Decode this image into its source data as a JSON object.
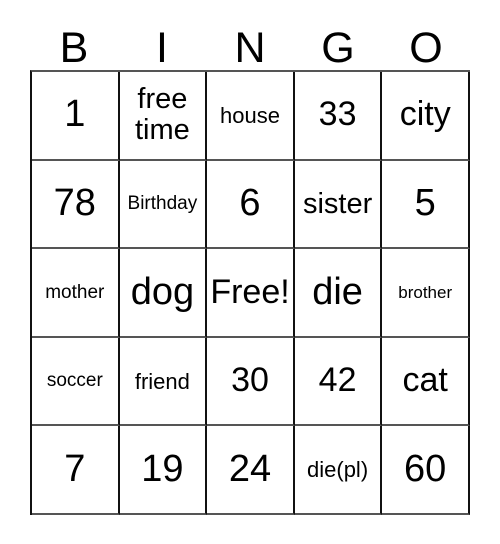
{
  "card": {
    "header": {
      "letters": [
        "B",
        "I",
        "N",
        "G",
        "O"
      ]
    },
    "grid": {
      "rows": 5,
      "columns": 5,
      "free_space_label": "Free!",
      "cells": [
        [
          {
            "text": "1",
            "size": "fs-xl"
          },
          {
            "text": "free time",
            "size": "fs-md",
            "wrap": true
          },
          {
            "text": "house",
            "size": "fs-sm"
          },
          {
            "text": "33",
            "size": "fs-lg"
          },
          {
            "text": "city",
            "size": "fs-lg"
          }
        ],
        [
          {
            "text": "78",
            "size": "fs-xl"
          },
          {
            "text": "Birthday",
            "size": "fs-xs"
          },
          {
            "text": "6",
            "size": "fs-xl"
          },
          {
            "text": "sister",
            "size": "fs-md"
          },
          {
            "text": "5",
            "size": "fs-xl"
          }
        ],
        [
          {
            "text": "mother",
            "size": "fs-xs"
          },
          {
            "text": "dog",
            "size": "fs-xl"
          },
          {
            "text": "Free!",
            "size": "fs-lg"
          },
          {
            "text": "die",
            "size": "fs-xl"
          },
          {
            "text": "brother",
            "size": "fs-xxs"
          }
        ],
        [
          {
            "text": "soccer",
            "size": "fs-xs"
          },
          {
            "text": "friend",
            "size": "fs-sm"
          },
          {
            "text": "30",
            "size": "fs-lg"
          },
          {
            "text": "42",
            "size": "fs-lg"
          },
          {
            "text": "cat",
            "size": "fs-lg"
          }
        ],
        [
          {
            "text": "7",
            "size": "fs-xl"
          },
          {
            "text": "19",
            "size": "fs-xl"
          },
          {
            "text": "24",
            "size": "fs-xl"
          },
          {
            "text": "die(pl)",
            "size": "fs-sm"
          },
          {
            "text": "60",
            "size": "fs-xl"
          }
        ]
      ]
    },
    "colors": {
      "background": "#ffffff",
      "text": "#000000",
      "grid_line_dark": "#111111",
      "grid_line_light": "#555555"
    }
  }
}
